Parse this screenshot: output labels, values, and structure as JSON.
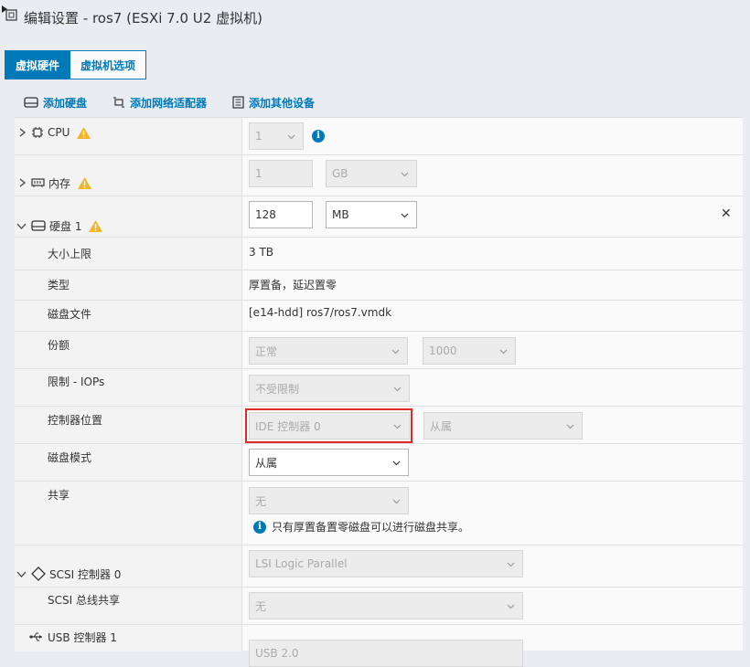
{
  "window": {
    "title": "编辑设置 - ros7 (ESXi 7.0 U2 虚拟机)"
  },
  "tabs": [
    {
      "label": "虚拟硬件",
      "active": true
    },
    {
      "label": "虚拟机选项",
      "active": false
    }
  ],
  "actions": {
    "add_disk": "添加硬盘",
    "add_nic": "添加网络适配器",
    "add_other": "添加其他设备"
  },
  "cpu": {
    "label": "CPU",
    "count": "1"
  },
  "memory": {
    "label": "内存",
    "size": "1",
    "unit": "GB"
  },
  "disk": {
    "label": "硬盘 1",
    "size": "128",
    "unit": "MB",
    "max_size": {
      "label": "大小上限",
      "value": "3 TB"
    },
    "type": {
      "label": "类型",
      "value": "厚置备，延迟置零"
    },
    "file": {
      "label": "磁盘文件",
      "value": "[e14-hdd] ros7/ros7.vmdk"
    },
    "shares": {
      "label": "份额",
      "level": "正常",
      "value": "1000"
    },
    "limit": {
      "label": "限制 - IOPs",
      "value": "不受限制"
    },
    "controller": {
      "label": "控制器位置",
      "controller": "IDE 控制器 0",
      "slot": "从属"
    },
    "mode": {
      "label": "磁盘模式",
      "value": "从属"
    },
    "sharing": {
      "label": "共享",
      "value": "无",
      "note": "只有厚置备置零磁盘可以进行磁盘共享。"
    }
  },
  "scsi": {
    "label": "SCSI 控制器 0",
    "type": "LSI Logic Parallel",
    "bus_sharing": {
      "label": "SCSI 总线共享",
      "value": "无"
    }
  },
  "usb": {
    "label": "USB 控制器 1",
    "value": "USB 2.0"
  },
  "colors": {
    "accent": "#0079b8",
    "highlight": "#e02a2a",
    "warning": "#f2b527"
  }
}
